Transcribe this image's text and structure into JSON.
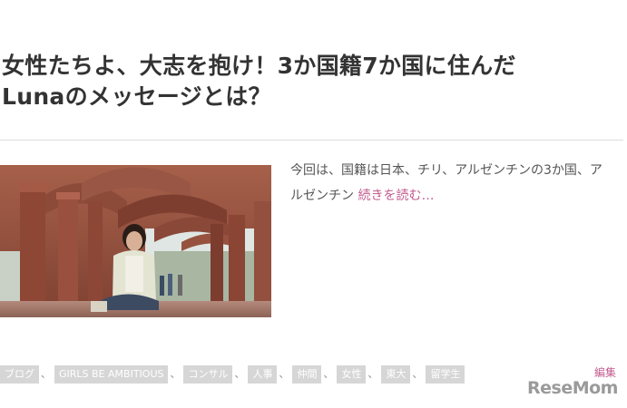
{
  "article": {
    "title_line1": "女性たちよ、大志を抱け！3か国籍7か国に住んだ",
    "title_line2": "Lunaのメッセージとは？",
    "excerpt": "今回は、国籍は日本、チリ、アルゼンチンの3か国、アルゼンチン",
    "read_more": "続きを読む…"
  },
  "tags": {
    "items": [
      "ブログ",
      "GIRLS BE AMBITIOUS",
      "コンサル",
      "人事",
      "仲間",
      "女性",
      "東大",
      "留学生"
    ],
    "separator": "、"
  },
  "edit_label": "編集",
  "watermark": "ReseMom",
  "colors": {
    "accent_pink": "#c35b8e",
    "tag_bg": "#d6d6d6",
    "text": "#333333"
  }
}
